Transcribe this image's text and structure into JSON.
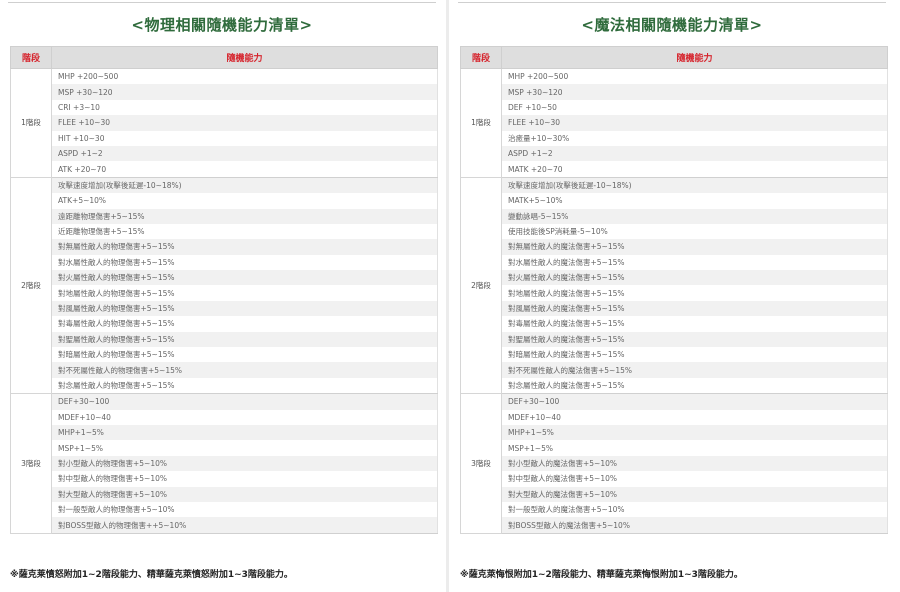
{
  "left": {
    "title": "<物理相關隨機能力清單>",
    "headers": [
      "階段",
      "隨機能力"
    ],
    "groups": [
      {
        "tier": "1階段",
        "items": [
          "MHP +200~500",
          "MSP +30~120",
          "CRI +3~10",
          "FLEE +10~30",
          "HIT +10~30",
          "ASPD +1~2",
          "ATK +20~70"
        ]
      },
      {
        "tier": "2階段",
        "items": [
          "攻擊速度增加(攻擊後延遲-10~18%)",
          "ATK+5~10%",
          "遠距離物理傷害+5~15%",
          "近距離物理傷害+5~15%",
          "對無屬性敵人的物理傷害+5~15%",
          "對水屬性敵人的物理傷害+5~15%",
          "對火屬性敵人的物理傷害+5~15%",
          "對地屬性敵人的物理傷害+5~15%",
          "對風屬性敵人的物理傷害+5~15%",
          "對毒屬性敵人的物理傷害+5~15%",
          "對聖屬性敵人的物理傷害+5~15%",
          "對暗屬性敵人的物理傷害+5~15%",
          "對不死屬性敵人的物理傷害+5~15%",
          "對念屬性敵人的物理傷害+5~15%"
        ]
      },
      {
        "tier": "3階段",
        "items": [
          "DEF+30~100",
          "MDEF+10~40",
          "MHP+1~5%",
          "MSP+1~5%",
          "對小型敵人的物理傷害+5~10%",
          "對中型敵人的物理傷害+5~10%",
          "對大型敵人的物理傷害+5~10%",
          "對一般型敵人的物理傷害+5~10%",
          "對BOSS型敵人的物理傷害++5~10%"
        ]
      }
    ],
    "note": "※薩克莱憤怒附加1~2階段能力、精華薩克萊憤怒附加1~3階段能力。"
  },
  "right": {
    "title": "<魔法相關隨機能力清單>",
    "headers": [
      "階段",
      "隨機能力"
    ],
    "groups": [
      {
        "tier": "1階段",
        "items": [
          "MHP +200~500",
          "MSP +30~120",
          "DEF +10~50",
          "FLEE +10~30",
          "治癒量+10~30%",
          "ASPD +1~2",
          "MATK +20~70"
        ]
      },
      {
        "tier": "2階段",
        "items": [
          "攻擊速度增加(攻擊後延遲-10~18%)",
          "MATK+5~10%",
          "變動詠唱-5~15%",
          "使用技能後SP消耗量-5~10%",
          "對無屬性敵人的魔法傷害+5~15%",
          "對水屬性敵人的魔法傷害+5~15%",
          "對火屬性敵人的魔法傷害+5~15%",
          "對地屬性敵人的魔法傷害+5~15%",
          "對風屬性敵人的魔法傷害+5~15%",
          "對毒屬性敵人的魔法傷害+5~15%",
          "對聖屬性敵人的魔法傷害+5~15%",
          "對暗屬性敵人的魔法傷害+5~15%",
          "對不死屬性敵人的魔法傷害+5~15%",
          "對念屬性敵人的魔法傷害+5~15%"
        ]
      },
      {
        "tier": "3階段",
        "items": [
          "DEF+30~100",
          "MDEF+10~40",
          "MHP+1~5%",
          "MSP+1~5%",
          "對小型敵人的魔法傷害+5~10%",
          "對中型敵人的魔法傷害+5~10%",
          "對大型敵人的魔法傷害+5~10%",
          "對一般型敵人的魔法傷害+5~10%",
          "對BOSS型敵人的魔法傷害+5~10%"
        ]
      }
    ],
    "note": "※薩克萊悔恨附加1~2階段能力、精華薩克萊悔恨附加1~3階段能力。"
  }
}
